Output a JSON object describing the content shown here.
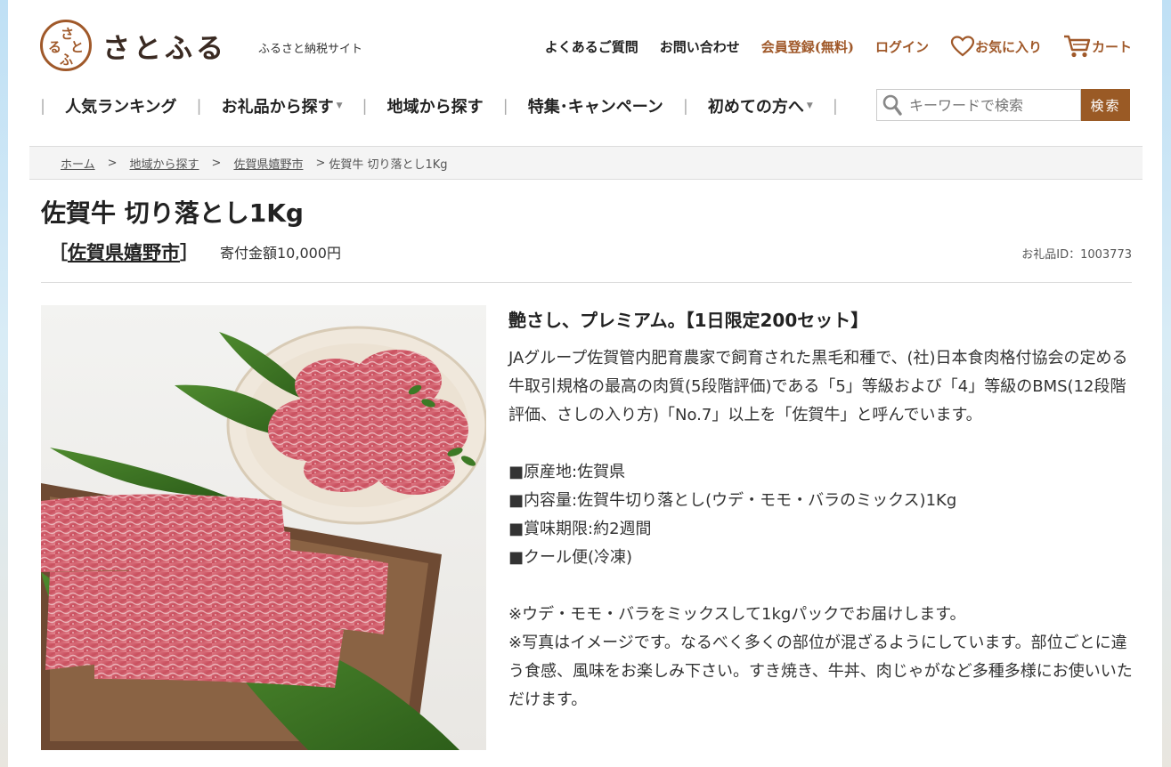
{
  "header": {
    "logo_text": "さとふる",
    "logo_mark_chars": [
      "さ",
      "と",
      "ふ",
      "る"
    ],
    "tagline": "ふるさと納税サイト",
    "links": {
      "faq": "よくあるご質問",
      "contact": "お問い合わせ",
      "register": "会員登録(無料)",
      "login": "ログイン",
      "favorites": "お気に入り",
      "cart": "カート"
    }
  },
  "main_nav": {
    "ranking": "人気ランキング",
    "by_gift": "お礼品から探す",
    "by_region": "地域から探す",
    "campaigns": "特集･キャンペーン",
    "beginners": "初めての方へ"
  },
  "search": {
    "placeholder": "キーワードで検索",
    "button": "検索"
  },
  "breadcrumb": {
    "home": "ホーム",
    "region_search": "地域から探す",
    "city": "佐賀県嬉野市",
    "current": "佐賀牛 切り落とし1Kg"
  },
  "product": {
    "title": "佐賀牛 切り落とし1Kg",
    "region": "佐賀県嬉野市",
    "price": "寄付金額10,000円",
    "id_label": "お礼品ID：1003773",
    "catch": "艶さし、プレミアム。【1日限定200セット】",
    "description": "JAグループ佐賀管内肥育農家で飼育された黒毛和種で、(社)日本食肉格付協会の定める牛取引規格の最高の肉質(5段階評価)である「5」等級および「4」等級のBMS(12段階評価、さしの入り方)「No.7」以上を「佐賀牛」と呼んでいます。",
    "specs": [
      "■原産地:佐賀県",
      "■内容量:佐賀牛切り落とし(ウデ・モモ・バラのミックス)1Kg",
      "■賞味期限:約2週間",
      "■クール便(冷凍)"
    ],
    "notes": [
      "※ウデ・モモ・バラをミックスして1kgパックでお届けします。",
      "※写真はイメージです。なるべく多くの部位が混ざるようにしています。部位ごとに違う食感、風味をお楽しみ下さい。すき焼き、牛丼、肉じゃがなど多種多様にお使いいただけます。"
    ]
  },
  "colors": {
    "brand_brown": "#a0592a",
    "search_button": "#9a5a25"
  }
}
